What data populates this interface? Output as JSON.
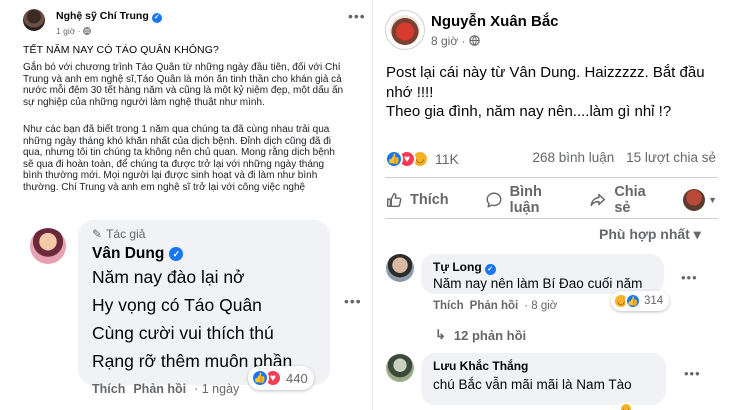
{
  "left_post": {
    "author": "Nghệ sỹ Chí Trung",
    "time": "1 giờ · ",
    "headline": "TẾT NĂM NAY CÓ TÁO QUÂN KHÔNG?",
    "paragraph1": "Gắn bó với chương trình Táo Quân từ những ngày đầu tiên, đối với Chí Trung và anh em nghệ sĩ,Táo Quân là món ăn tinh thần cho khán giả cả nước mỗi đêm 30 tết hàng năm và cũng là một kỷ niệm đẹp, một dấu ấn sự nghiệp của những người làm nghệ thuật như mình.",
    "paragraph2": "Như các bạn đã biết trong 1 năm qua chúng ta đã cùng nhau trải qua những ngày tháng khó khăn nhất của dịch bệnh. Đỉnh dịch cũng đã đi qua, nhưng tôi tin chúng ta không nên chủ quan. Mong rằng dịch bệnh sẽ qua đi hoàn toàn, để chúng ta được trở lại với những ngày tháng bình thường mới. Mọi người lại được sinh hoạt và đi làm như bình thường. Chí Trung và anh em nghệ sĩ trở lại với công việc nghệ"
  },
  "right_post": {
    "author": "Nguyễn Xuân Bắc",
    "time": "8 giờ · ",
    "text1": "Post lại cái này từ Vân Dung. Haizzzzz. Bắt đầu nhớ !!!!",
    "text2": "Theo gia đình, năm nay nên....làm gì nhỉ !?",
    "reaction_count": "11K",
    "comments_count": "268 bình luận",
    "shares_count": "15 lượt chia sẻ",
    "actions": {
      "like": "Thích",
      "comment": "Bình luận",
      "share": "Chia sẻ"
    },
    "sort": "Phù hợp nhất ▾"
  },
  "left_comment": {
    "author_badge": "Tác giả",
    "name": "Vân Dung",
    "lines": [
      "Năm nay đào lại nở",
      "Hy vọng có Táo Quân",
      "Cùng cười vui thích thú",
      "Rạng rỡ thêm muôn phần"
    ],
    "like": "Thích",
    "reply": "Phản hồi",
    "time": "· 1 ngày",
    "reaction_count": "440"
  },
  "right_comments": [
    {
      "name": "Tự Long",
      "text": "Năm nay nên làm Bí Đao cuối năm",
      "like": "Thích",
      "reply": "Phản hồi",
      "time": "· 8 giờ",
      "reaction_count": "314",
      "replies": "12 phản hồi"
    },
    {
      "name": "Lưu Khắc Thắng",
      "text": "chú Bắc vẫn mãi mãi là Nam Tào"
    }
  ],
  "colors": {
    "facebook_blue": "#1877f2",
    "love_red": "#f33e58",
    "haha_yellow": "#f7b125",
    "bubble_gray": "#f0f2f5",
    "secondary_text": "#65676b"
  }
}
